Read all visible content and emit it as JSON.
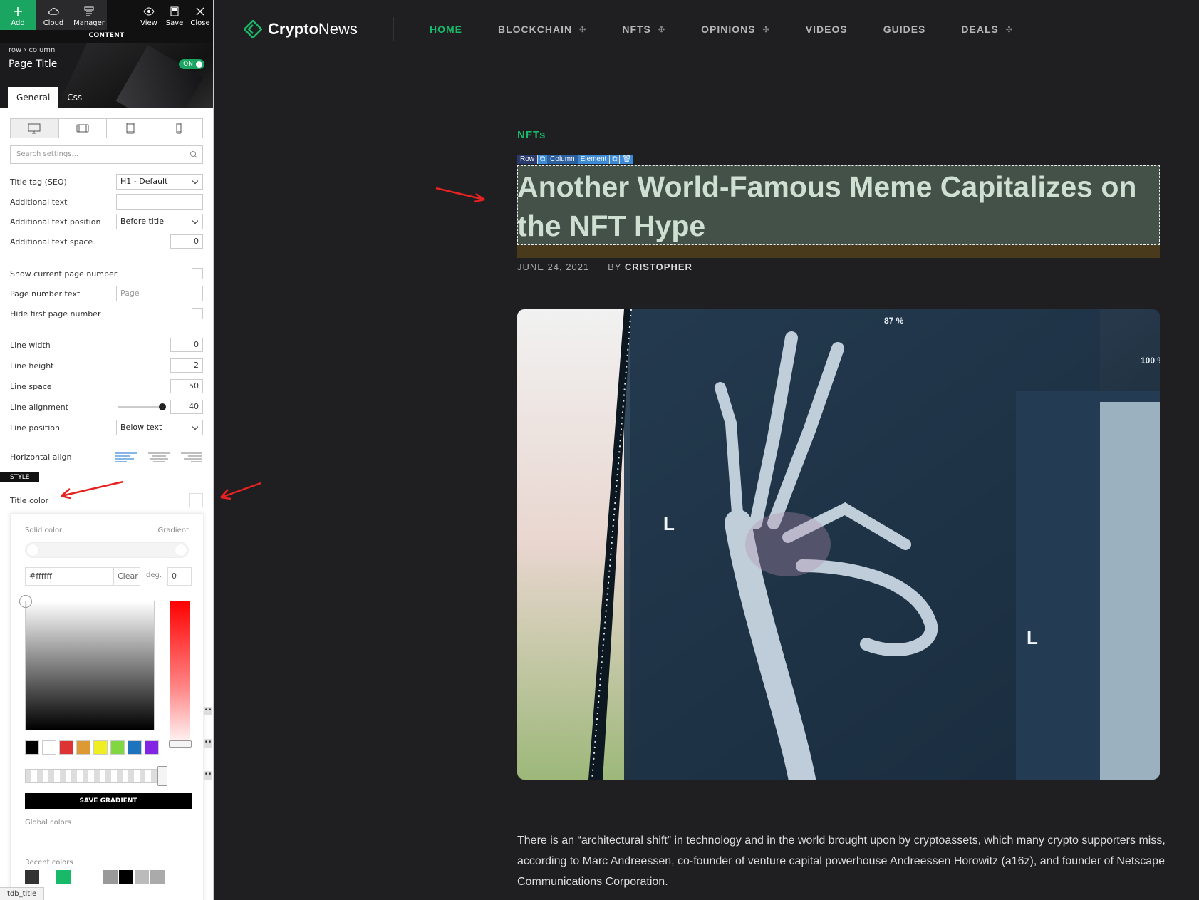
{
  "toolbar": {
    "add": "Add",
    "cloud": "Cloud",
    "manager": "Manager",
    "view": "View",
    "save": "Save",
    "close": "Close"
  },
  "panel": {
    "section_label": "CONTENT",
    "breadcrumb": "row › column",
    "page_title": "Page Title",
    "toggle": "ON",
    "tabs": [
      "General",
      "Css"
    ],
    "search_placeholder": "Search settings...",
    "title_tag_label": "Title tag (SEO)",
    "title_tag_value": "H1 - Default",
    "additional_text_label": "Additional text",
    "additional_text_value": "",
    "additional_text_position_label": "Additional text position",
    "additional_text_position_value": "Before title",
    "additional_text_space_label": "Additional text space",
    "additional_text_space_value": "0",
    "show_page_number_label": "Show current page number",
    "page_number_text_label": "Page number text",
    "page_number_text_placeholder": "Page",
    "hide_first_page_label": "Hide first page number",
    "line_width_label": "Line width",
    "line_width_value": "0",
    "line_height_label": "Line height",
    "line_height_value": "2",
    "line_space_label": "Line space",
    "line_space_value": "50",
    "line_alignment_label": "Line alignment",
    "line_alignment_value": "40",
    "line_position_label": "Line position",
    "line_position_value": "Below text",
    "horizontal_align_label": "Horizontal align",
    "style_label": "STYLE",
    "title_color_label": "Title color",
    "picker": {
      "solid": "Solid color",
      "gradient": "Gradient",
      "hex": "#ffffff",
      "clear": "Clear",
      "deg_label": "deg.",
      "deg_value": "0",
      "swatches": [
        "#000000",
        "#ffffff",
        "#dd3333",
        "#dd9933",
        "#eeee22",
        "#81d742",
        "#1e73be",
        "#8224e3"
      ],
      "save_gradient": "SAVE GRADIENT",
      "global_colors": "Global colors",
      "recent_colors": "Recent colors",
      "recent": [
        "#333333",
        "#ffffff",
        "#19b96a",
        "#ffffff",
        "#ffffff",
        "#999999",
        "#000000",
        "#bbbbbb",
        "#aaaaaa"
      ]
    },
    "status_tag": "tdb_title"
  },
  "site": {
    "logo_bold": "Crypto",
    "logo_light": "News",
    "nav": [
      {
        "label": "HOME",
        "active": true,
        "plus": false
      },
      {
        "label": "BLOCKCHAIN",
        "active": false,
        "plus": true
      },
      {
        "label": "NFTS",
        "active": false,
        "plus": true
      },
      {
        "label": "OPINIONS",
        "active": false,
        "plus": true
      },
      {
        "label": "VIDEOS",
        "active": false,
        "plus": false
      },
      {
        "label": "GUIDES",
        "active": false,
        "plus": false
      },
      {
        "label": "DEALS",
        "active": false,
        "plus": true
      }
    ],
    "category": "NFTs",
    "editor_tags": {
      "row": "Row",
      "column": "Column",
      "element": "Element"
    },
    "title": "Another World-Famous Meme Capitalizes on the NFT Hype",
    "date": "JUNE 24, 2021",
    "by": "BY",
    "author": "CRISTOPHER",
    "xray_labels": [
      "87 %",
      "100 %"
    ],
    "body": "There is an “architectural shift” in technology and in the world brought upon by cryptoassets, which many crypto supporters miss, according to Marc Andreessen, co-founder of venture capital powerhouse Andreessen Horowitz (a16z), and founder of Netscape Communications Corporation.",
    "accent": "#19b96a"
  }
}
